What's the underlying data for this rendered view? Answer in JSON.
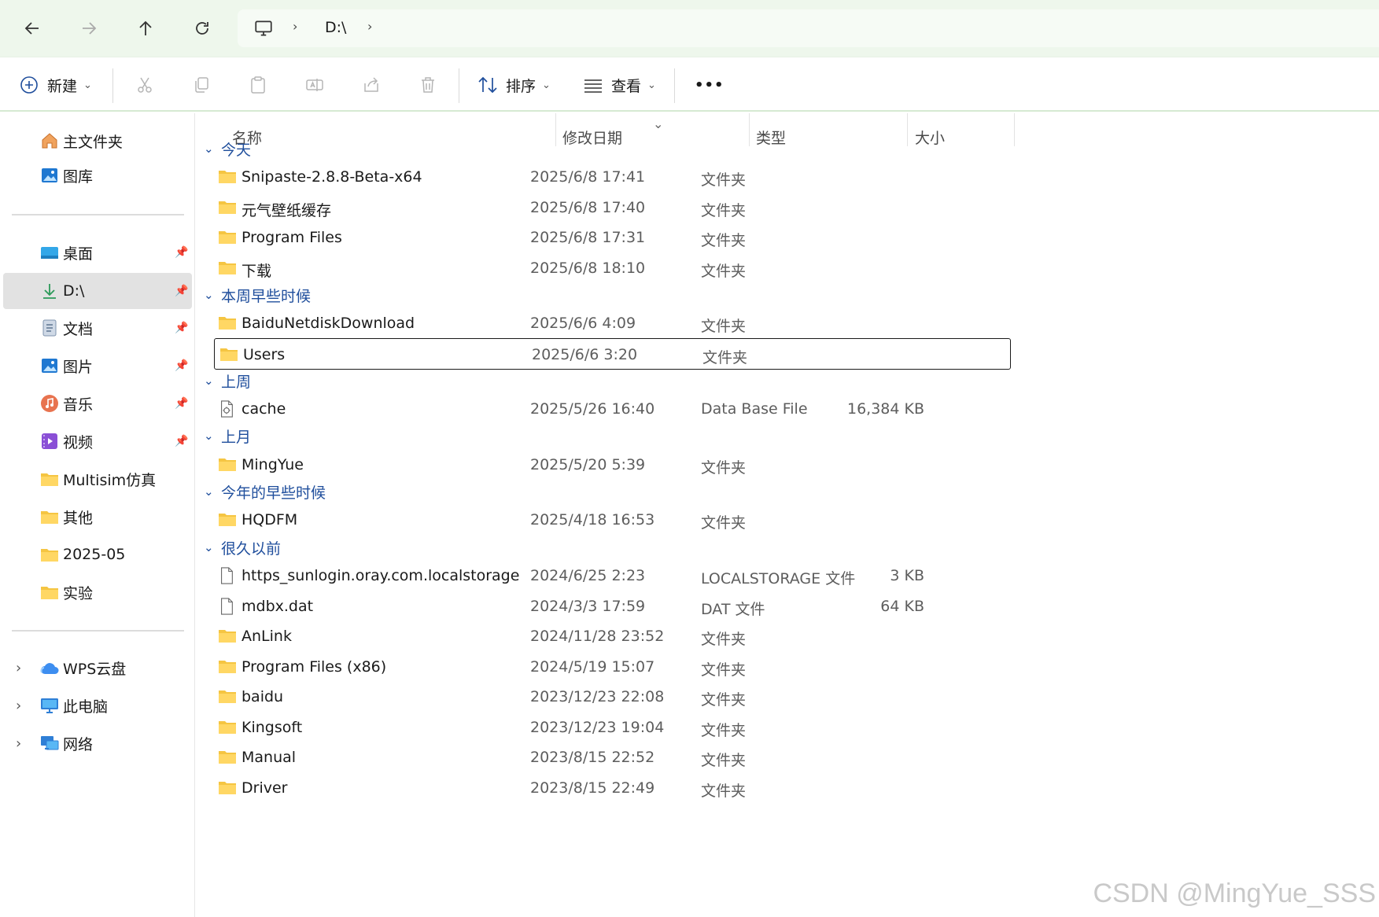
{
  "address": {
    "root_icon": "monitor-icon",
    "path": "D:\\"
  },
  "toolbar": {
    "new_label": "新建",
    "sort_label": "排序",
    "view_label": "查看",
    "more_label": "•••"
  },
  "sidebar": {
    "top_items": [
      {
        "label": "主文件夹",
        "icon": "home-icon"
      },
      {
        "label": "图库",
        "icon": "gallery-icon"
      }
    ],
    "pinned_items": [
      {
        "label": "桌面",
        "icon": "desktop-icon",
        "pinned": true
      },
      {
        "label": "D:\\",
        "icon": "download-icon",
        "pinned": true,
        "selected": true
      },
      {
        "label": "文档",
        "icon": "document-icon",
        "pinned": true
      },
      {
        "label": "图片",
        "icon": "picture-icon",
        "pinned": true
      },
      {
        "label": "音乐",
        "icon": "music-icon",
        "pinned": true
      },
      {
        "label": "视频",
        "icon": "video-icon",
        "pinned": true
      },
      {
        "label": "Multisim仿真",
        "icon": "folder-icon",
        "pinned": false
      },
      {
        "label": "其他",
        "icon": "folder-icon",
        "pinned": false
      },
      {
        "label": "2025-05",
        "icon": "folder-icon",
        "pinned": false
      },
      {
        "label": "实验",
        "icon": "folder-icon",
        "pinned": false
      }
    ],
    "tree_items": [
      {
        "label": "WPS云盘",
        "icon": "cloud-icon"
      },
      {
        "label": "此电脑",
        "icon": "computer-icon"
      },
      {
        "label": "网络",
        "icon": "network-icon"
      }
    ]
  },
  "columns": {
    "name": "名称",
    "modified": "修改日期",
    "type": "类型",
    "size": "大小"
  },
  "groups": [
    {
      "title": "今天",
      "rows": [
        {
          "name": "Snipaste-2.8.8-Beta-x64",
          "date": "2025/6/8 17:41",
          "type": "文件夹",
          "size": "",
          "icon": "folder-icon"
        },
        {
          "name": "元气壁纸缓存",
          "date": "2025/6/8 17:40",
          "type": "文件夹",
          "size": "",
          "icon": "folder-icon"
        },
        {
          "name": "Program Files",
          "date": "2025/6/8 17:31",
          "type": "文件夹",
          "size": "",
          "icon": "folder-icon"
        },
        {
          "name": "下载",
          "date": "2025/6/8 18:10",
          "type": "文件夹",
          "size": "",
          "icon": "folder-icon"
        }
      ]
    },
    {
      "title": "本周早些时候",
      "rows": [
        {
          "name": "BaiduNetdiskDownload",
          "date": "2025/6/6 4:09",
          "type": "文件夹",
          "size": "",
          "icon": "folder-icon"
        },
        {
          "name": "Users",
          "date": "2025/6/6 3:20",
          "type": "文件夹",
          "size": "",
          "icon": "folder-icon",
          "focused": true
        }
      ]
    },
    {
      "title": "上周",
      "rows": [
        {
          "name": "cache",
          "date": "2025/5/26 16:40",
          "type": "Data Base File",
          "size": "16,384 KB",
          "icon": "database-file-icon"
        }
      ]
    },
    {
      "title": "上月",
      "rows": [
        {
          "name": "MingYue",
          "date": "2025/5/20 5:39",
          "type": "文件夹",
          "size": "",
          "icon": "folder-icon"
        }
      ]
    },
    {
      "title": "今年的早些时候",
      "rows": [
        {
          "name": "HQDFM",
          "date": "2025/4/18 16:53",
          "type": "文件夹",
          "size": "",
          "icon": "folder-icon"
        }
      ]
    },
    {
      "title": "很久以前",
      "rows": [
        {
          "name": "https_sunlogin.oray.com.localstorage",
          "date": "2024/6/25 2:23",
          "type": "LOCALSTORAGE 文件",
          "size": "3 KB",
          "icon": "file-icon"
        },
        {
          "name": "mdbx.dat",
          "date": "2024/3/3 17:59",
          "type": "DAT 文件",
          "size": "64 KB",
          "icon": "file-icon"
        },
        {
          "name": "AnLink",
          "date": "2024/11/28 23:52",
          "type": "文件夹",
          "size": "",
          "icon": "folder-icon"
        },
        {
          "name": "Program Files (x86)",
          "date": "2024/5/19 15:07",
          "type": "文件夹",
          "size": "",
          "icon": "folder-icon"
        },
        {
          "name": "baidu",
          "date": "2023/12/23 22:08",
          "type": "文件夹",
          "size": "",
          "icon": "folder-icon"
        },
        {
          "name": "Kingsoft",
          "date": "2023/12/23 19:04",
          "type": "文件夹",
          "size": "",
          "icon": "folder-icon"
        },
        {
          "name": "Manual",
          "date": "2023/8/15 22:52",
          "type": "文件夹",
          "size": "",
          "icon": "folder-icon"
        },
        {
          "name": "Driver",
          "date": "2023/8/15 22:49",
          "type": "文件夹",
          "size": "",
          "icon": "folder-icon"
        }
      ]
    }
  ],
  "watermark": "CSDN @MingYue_SSS",
  "colors": {
    "titlebar": "#eef7ec",
    "group_heading": "#1f4e9c",
    "folder": "#f5c542",
    "selected_sidebar": "#e2e2e2"
  }
}
